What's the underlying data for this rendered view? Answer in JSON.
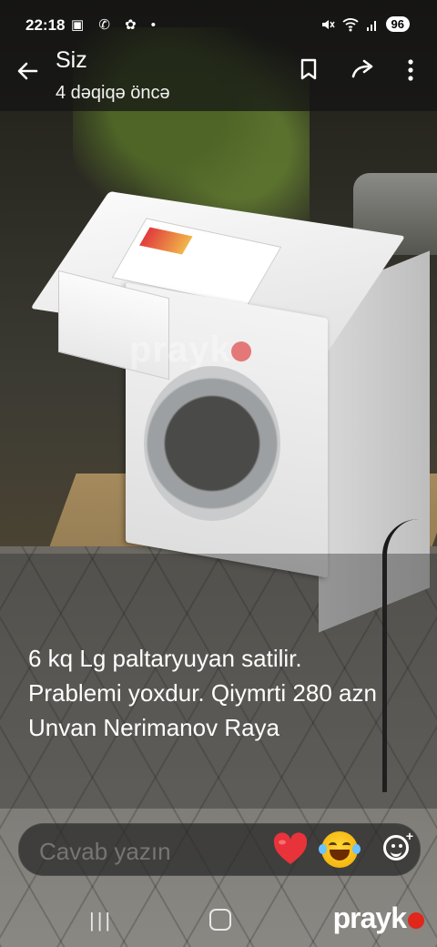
{
  "status_bar": {
    "time": "22:18",
    "left_icons": "▣ ✆ ✿ •",
    "battery": "96",
    "icons": [
      "mute-icon",
      "wifi-icon",
      "signal-icon"
    ]
  },
  "header": {
    "title": "Siz",
    "subtitle": "4 dəqiqə öncə",
    "icons": [
      "back-arrow-icon",
      "bookmark-icon",
      "forward-share-icon",
      "more-vert-icon"
    ]
  },
  "story": {
    "caption": "6 kq Lg paltaryuyan  satilir. Prablemi yoxdur. Qiymrti 280 azn Unvan Nerimanov Raya",
    "photo_watermark": "prayk"
  },
  "reply_bar": {
    "placeholder": "Cavab yazın",
    "reactions": [
      "heart-emoji",
      "laughing-tears-emoji"
    ],
    "icons": [
      "add-sticker-icon"
    ]
  },
  "nav_bar": {
    "recent": "|||",
    "brand": "prayk"
  },
  "colors": {
    "brand_red": "#e1261c",
    "heart_red": "#e8333a",
    "emoji_yellow": "#ffd93b"
  }
}
